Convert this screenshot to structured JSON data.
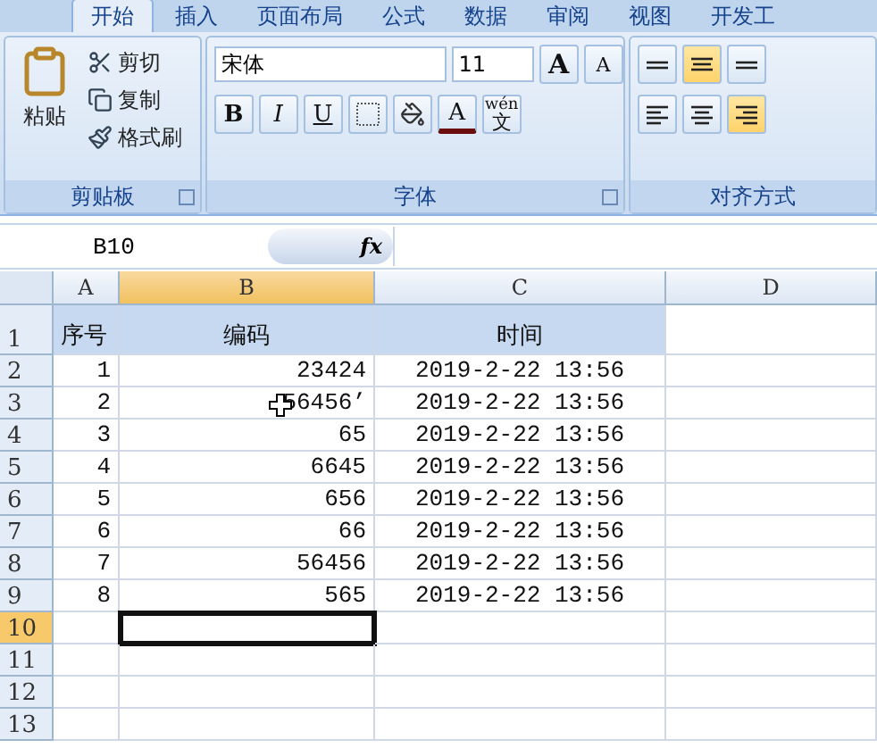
{
  "tabs": [
    {
      "label": "开始",
      "selected": true
    },
    {
      "label": "插入",
      "selected": false
    },
    {
      "label": "页面布局",
      "selected": false
    },
    {
      "label": "公式",
      "selected": false
    },
    {
      "label": "数据",
      "selected": false
    },
    {
      "label": "审阅",
      "selected": false
    },
    {
      "label": "视图",
      "selected": false
    },
    {
      "label": "开发工",
      "selected": false
    }
  ],
  "clipboard": {
    "paste": "粘贴",
    "items": [
      {
        "kind": "cut",
        "label": "剪切"
      },
      {
        "kind": "copy",
        "label": "复制"
      },
      {
        "kind": "brush",
        "label": "格式刷"
      }
    ],
    "title": "剪贴板"
  },
  "font": {
    "name": "宋体",
    "size": "11",
    "grow": "A",
    "shrink": "A",
    "bold": "B",
    "italic": "I",
    "underline": "U",
    "color_letter": "A",
    "phonetic": "wén",
    "phonetic_char": "文",
    "title": "字体"
  },
  "alignment": {
    "vertical": [
      {
        "kind": "top",
        "selected": false
      },
      {
        "kind": "middle",
        "selected": true
      },
      {
        "kind": "bottom",
        "selected": false
      }
    ],
    "horizontal": [
      {
        "kind": "left",
        "selected": false
      },
      {
        "kind": "center",
        "selected": false
      },
      {
        "kind": "right",
        "selected": true
      }
    ],
    "title": "对齐方式"
  },
  "name_box": "B10",
  "formula_label": "fx",
  "columns": [
    {
      "label": "A",
      "selected": false
    },
    {
      "label": "B",
      "selected": true
    },
    {
      "label": "C",
      "selected": false
    },
    {
      "label": "D",
      "selected": false
    }
  ],
  "rows": [
    {
      "number": "1",
      "selected": false,
      "kind": "header",
      "cells": [
        "序号",
        "编码",
        "时间",
        ""
      ]
    },
    {
      "number": "2",
      "selected": false,
      "kind": "data",
      "cells": [
        "1",
        "23424",
        "2019-2-22 13:56",
        ""
      ]
    },
    {
      "number": "3",
      "selected": false,
      "kind": "data",
      "cells": [
        "2",
        "56456’",
        "2019-2-22 13:56",
        ""
      ]
    },
    {
      "number": "4",
      "selected": false,
      "kind": "data",
      "cells": [
        "3",
        "65",
        "2019-2-22 13:56",
        ""
      ]
    },
    {
      "number": "5",
      "selected": false,
      "kind": "data",
      "cells": [
        "4",
        "6645",
        "2019-2-22 13:56",
        ""
      ]
    },
    {
      "number": "6",
      "selected": false,
      "kind": "data",
      "cells": [
        "5",
        "656",
        "2019-2-22 13:56",
        ""
      ]
    },
    {
      "number": "7",
      "selected": false,
      "kind": "data",
      "cells": [
        "6",
        "66",
        "2019-2-22 13:56",
        ""
      ]
    },
    {
      "number": "8",
      "selected": false,
      "kind": "data",
      "cells": [
        "7",
        "56456",
        "2019-2-22 13:56",
        ""
      ]
    },
    {
      "number": "9",
      "selected": false,
      "kind": "data",
      "cells": [
        "8",
        "565",
        "2019-2-22 13:56",
        ""
      ]
    },
    {
      "number": "10",
      "selected": true,
      "kind": "data",
      "cells": [
        "",
        "",
        "",
        ""
      ]
    },
    {
      "number": "11",
      "selected": false,
      "kind": "data",
      "cells": [
        "",
        "",
        "",
        ""
      ]
    },
    {
      "number": "12",
      "selected": false,
      "kind": "data",
      "cells": [
        "",
        "",
        "",
        ""
      ]
    },
    {
      "number": "13",
      "selected": false,
      "kind": "data",
      "cells": [
        "",
        "",
        "",
        ""
      ]
    }
  ],
  "pointer_on_row_3": true
}
